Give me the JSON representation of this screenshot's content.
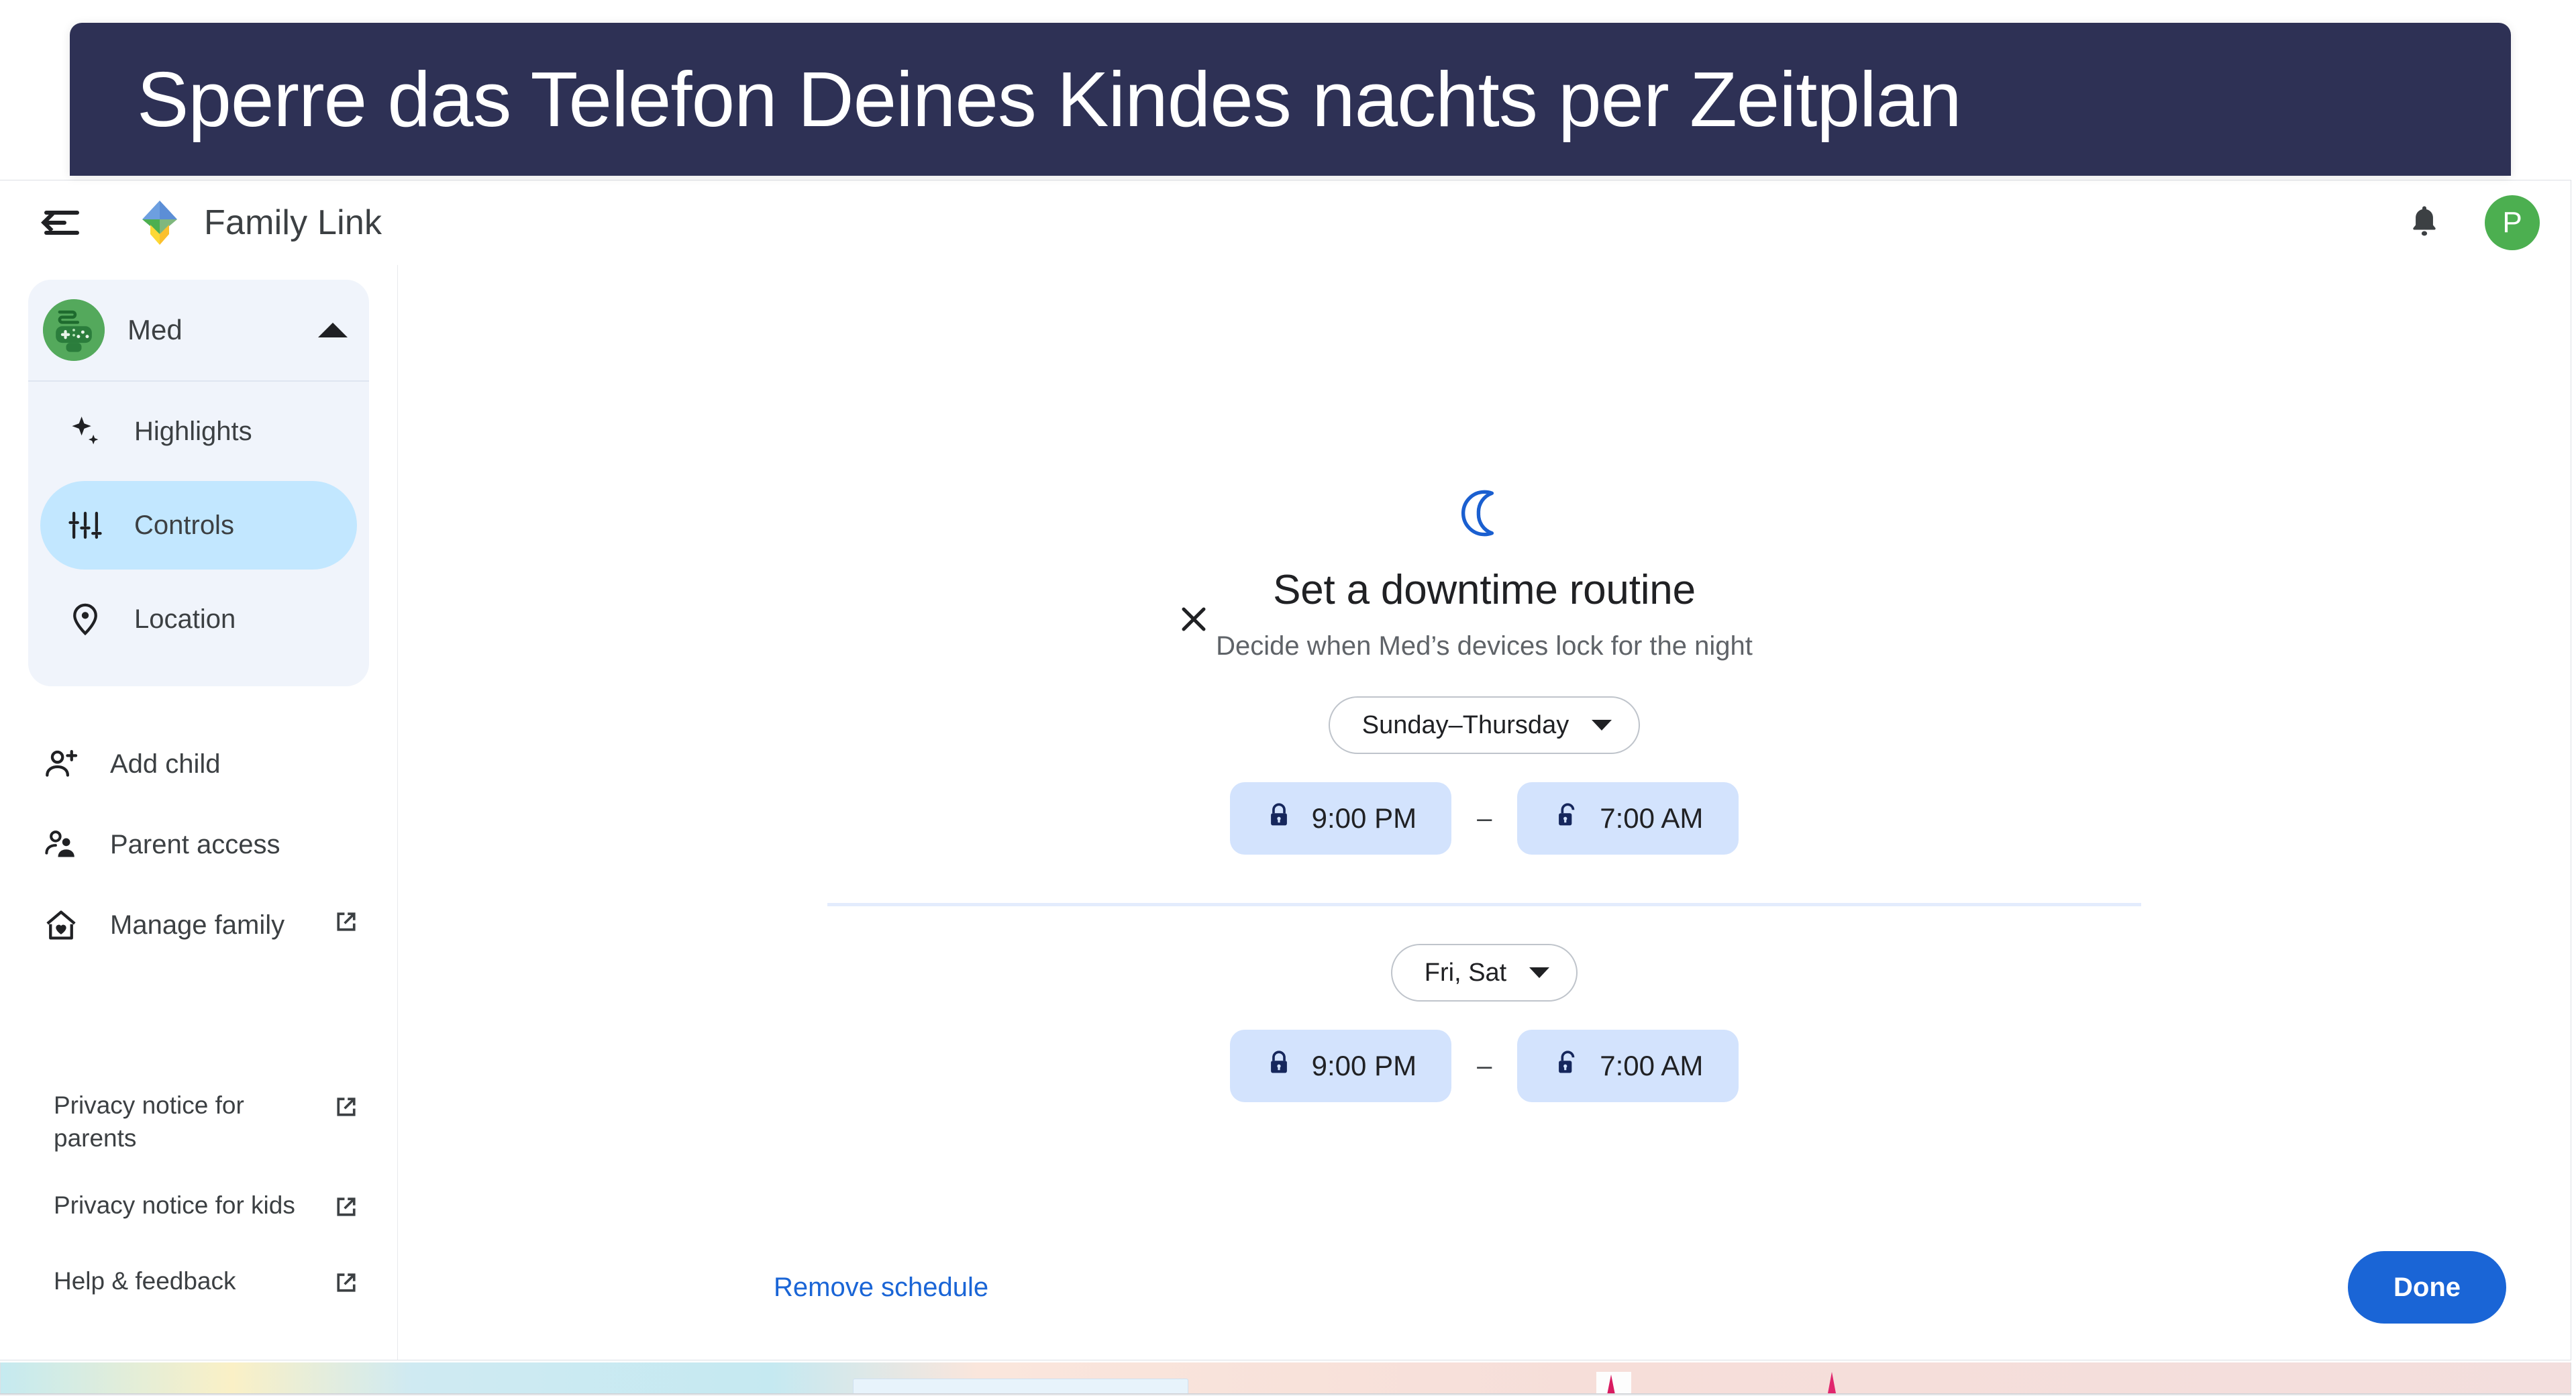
{
  "banner": {
    "text": "Sperre das Telefon Deines Kindes nachts per Zeitplan",
    "background_color": "#2e3155",
    "text_color": "#ffffff"
  },
  "app_bar": {
    "menu_icon": "menu-collapse-icon",
    "logo_icon": "family-link-logo",
    "title": "Family Link",
    "notifications_icon": "bell-icon",
    "account_avatar_initial": "P",
    "account_avatar_color": "#4caf50"
  },
  "sidebar": {
    "child": {
      "name": "Med",
      "avatar_icon": "game-controller-avatar",
      "avatar_color": "#54a95c",
      "expander_icon": "caret-up-icon",
      "expanded": true
    },
    "child_nav": [
      {
        "label": "Highlights",
        "icon": "sparkle-icon",
        "active": false
      },
      {
        "label": "Controls",
        "icon": "tune-sliders-icon",
        "active": true
      },
      {
        "label": "Location",
        "icon": "location-pin-icon",
        "active": false
      }
    ],
    "links": [
      {
        "label": "Add child",
        "icon": "person-add-icon",
        "external": false
      },
      {
        "label": "Parent access",
        "icon": "supervisor-account-icon",
        "external": false
      },
      {
        "label": "Manage family",
        "icon": "home-heart-icon",
        "external": true
      }
    ],
    "footer_links": [
      {
        "label": "Privacy notice for parents",
        "external": true
      },
      {
        "label": "Privacy notice for kids",
        "external": true
      },
      {
        "label": "Help & feedback",
        "external": true
      }
    ],
    "active_pill_color": "#c2e7ff",
    "panel_color": "#f0f4fb"
  },
  "dialog": {
    "close_icon": "close-icon",
    "hero_icon": "crescent-moon-icon",
    "hero_icon_color": "#1a5fd0",
    "title": "Set a downtime routine",
    "subtitle": "Decide when Med’s devices lock for the night",
    "schedules": [
      {
        "days_label": "Sunday–Thursday",
        "days_caret_icon": "chevron-down-icon",
        "start": {
          "time": "9:00 PM",
          "icon": "lock-closed-icon"
        },
        "separator": "–",
        "end": {
          "time": "7:00 AM",
          "icon": "lock-open-icon"
        }
      },
      {
        "days_label": "Fri, Sat",
        "days_caret_icon": "chevron-down-icon",
        "start": {
          "time": "9:00 PM",
          "icon": "lock-closed-icon"
        },
        "separator": "–",
        "end": {
          "time": "7:00 AM",
          "icon": "lock-open-icon"
        }
      }
    ],
    "remove_label": "Remove schedule",
    "done_label": "Done",
    "chip_background": "#d3e3fd",
    "primary_color": "#1a65d6",
    "link_color": "#1a65d6"
  }
}
